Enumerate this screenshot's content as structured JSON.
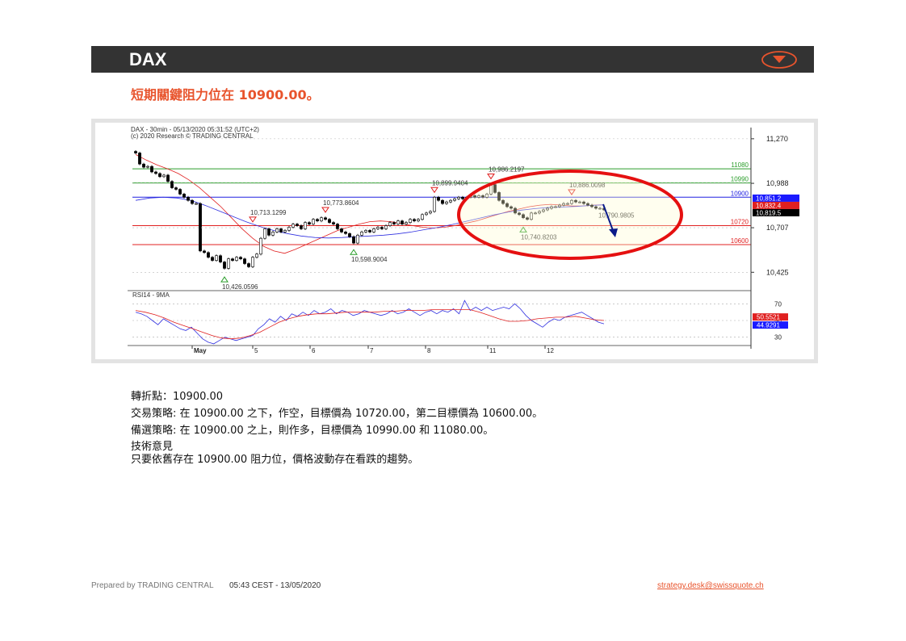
{
  "header": {
    "title": "DAX",
    "menu_icon": "chevron-down-circle-icon",
    "accent": "#e8542d"
  },
  "subtitle": "短期關鍵阻力位在  10900.00。",
  "chart_data": {
    "type": "candlestick",
    "title": "DAX - 30min - 05/13/2020 05:31:52 (UTC+2)",
    "subtitle": "(c) 2020 Research © TRADING CENTRAL",
    "x_ticks": [
      "May",
      "5",
      "6",
      "7",
      "8",
      "11",
      "12"
    ],
    "price_axis": {
      "ticks": [
        11270,
        10988,
        10707,
        10425
      ],
      "labels": [
        "11,270",
        "10,988",
        "10,707",
        "10,425"
      ],
      "ylim": [
        10360,
        11300
      ]
    },
    "price_badges": [
      {
        "value": "10,851.2",
        "color": "#1a1aff"
      },
      {
        "value": "10,832.4",
        "color": "#e02020"
      },
      {
        "value": "10,819.5",
        "color": "#000000"
      }
    ],
    "levels": [
      {
        "value": 11080,
        "label": "11080",
        "color": "#2a9d2a"
      },
      {
        "value": 10990,
        "label": "10990",
        "color": "#2a9d2a"
      },
      {
        "value": 10900,
        "label": "10900",
        "color": "#2020e0"
      },
      {
        "value": 10720,
        "label": "10720",
        "color": "#e02020"
      },
      {
        "value": 10600,
        "label": "10600",
        "color": "#e02020"
      }
    ],
    "annotations": [
      {
        "text": "10,426.0596",
        "t": 22,
        "value": 10426,
        "kind": "low"
      },
      {
        "text": "10,713.1299",
        "t": 29,
        "value": 10713,
        "kind": "high"
      },
      {
        "text": "10,773.8604",
        "t": 47,
        "value": 10774,
        "kind": "high"
      },
      {
        "text": "10,598.9004",
        "t": 54,
        "value": 10599,
        "kind": "low"
      },
      {
        "text": "10,899.9404",
        "t": 74,
        "value": 10900,
        "kind": "high"
      },
      {
        "text": "10,986.2197",
        "t": 88,
        "value": 10986,
        "kind": "high"
      },
      {
        "text": "10,740.8203",
        "t": 96,
        "value": 10741,
        "kind": "low"
      },
      {
        "text": "10,886.0098",
        "t": 108,
        "value": 10886,
        "kind": "high"
      },
      {
        "text": "10,790.9805",
        "t": 117,
        "value": 10791,
        "kind": "projection"
      }
    ],
    "close": [
      11180,
      11110,
      11090,
      11095,
      11060,
      11050,
      11030,
      11040,
      11000,
      10960,
      10950,
      10920,
      10900,
      10880,
      10860,
      10860,
      10560,
      10550,
      10520,
      10500,
      10530,
      10490,
      10450,
      10510,
      10500,
      10520,
      10510,
      10480,
      10460,
      10520,
      10540,
      10640,
      10700,
      10660,
      10680,
      10700,
      10680,
      10690,
      10710,
      10730,
      10720,
      10700,
      10740,
      10730,
      10760,
      10750,
      10770,
      10760,
      10740,
      10730,
      10700,
      10680,
      10670,
      10650,
      10610,
      10660,
      10680,
      10690,
      10680,
      10700,
      10710,
      10700,
      10720,
      10740,
      10730,
      10750,
      10730,
      10740,
      10760,
      10750,
      10760,
      10790,
      10800,
      10810,
      10900,
      10880,
      10860,
      10870,
      10880,
      10890,
      10900,
      10890,
      10900,
      10910,
      10900,
      10910,
      10900,
      10920,
      10980,
      10930,
      10880,
      10860,
      10840,
      10830,
      10800,
      10790,
      10770,
      10760,
      10800,
      10800,
      10810,
      10820,
      10830,
      10840,
      10840,
      10850,
      10860,
      10860,
      10880,
      10870,
      10870,
      10860,
      10850,
      10840,
      10830,
      10830,
      10820
    ],
    "ma_red": [
      11170,
      11135,
      11105,
      11080,
      11050,
      11010,
      10960,
      10900,
      10840,
      10770,
      10700,
      10640,
      10590,
      10560,
      10545,
      10570,
      10600,
      10630,
      10660,
      10690,
      10710,
      10730,
      10745,
      10750,
      10745,
      10735,
      10720,
      10710,
      10705,
      10710,
      10720,
      10735,
      10750,
      10770,
      10790,
      10810,
      10825,
      10840,
      10850,
      10855,
      10850,
      10845,
      10845,
      10850,
      10852
    ],
    "ma_blue": [
      10880,
      10895,
      10900,
      10895,
      10880,
      10850,
      10815,
      10780,
      10745,
      10715,
      10690,
      10670,
      10655,
      10645,
      10642,
      10645,
      10650,
      10655,
      10660,
      10668,
      10680,
      10695,
      10710,
      10728,
      10748,
      10768,
      10788,
      10805,
      10818,
      10828,
      10835,
      10838,
      10842,
      10848,
      10852
    ],
    "rsi": {
      "label": "RSI14 - 9MA",
      "levels": [
        70,
        50,
        30
      ],
      "ylim": [
        20,
        80
      ],
      "badges": [
        {
          "value": "50.5521",
          "color": "#e02020"
        },
        {
          "value": "44.9291",
          "color": "#1a1aff"
        }
      ],
      "rsi_values": [
        60,
        58,
        55,
        50,
        45,
        52,
        48,
        44,
        40,
        38,
        42,
        35,
        28,
        24,
        22,
        26,
        30,
        28,
        26,
        28,
        30,
        32,
        40,
        45,
        52,
        48,
        55,
        50,
        58,
        55,
        60,
        56,
        62,
        58,
        60,
        64,
        58,
        62,
        60,
        56,
        58,
        62,
        60,
        58,
        56,
        58,
        62,
        58,
        60,
        64,
        60,
        56,
        60,
        62,
        58,
        62,
        60,
        64,
        58,
        74,
        62,
        66,
        62,
        66,
        62,
        64,
        66,
        64,
        70,
        64,
        56,
        50,
        46,
        42,
        48,
        52,
        50,
        54,
        56,
        58,
        60,
        56,
        52,
        48,
        46
      ],
      "ma_values": [
        62,
        60,
        57,
        53,
        48,
        44,
        40,
        36,
        32,
        29,
        28,
        29,
        32,
        36,
        42,
        48,
        52,
        55,
        57,
        58,
        58,
        59,
        60,
        60,
        60,
        60,
        61,
        61,
        62,
        62,
        62,
        63,
        63,
        63,
        63,
        63,
        60,
        56,
        52,
        49,
        49,
        50,
        52,
        53,
        54,
        54,
        55,
        53,
        51,
        50
      ]
    }
  },
  "analysis": {
    "pivot": "轉折點：10900.00",
    "strategy": "交易策略: 在 10900.00 之下，作空，目標價為  10720.00，第二目標價為  10600.00。",
    "alternative": "備選策略: 在 10900.00 之上，則作多，目標價為  10990.00 和 11080.00。",
    "comment_title": "技術意見",
    "comment": "只要依舊存在  10900.00 阻力位，價格波動存在看跌的趨勢。"
  },
  "footer": {
    "prepared_by": "Prepared by TRADING CENTRAL",
    "timestamp": "05:43 CEST - 13/05/2020",
    "email": "strategy.desk@swissquote.ch"
  }
}
